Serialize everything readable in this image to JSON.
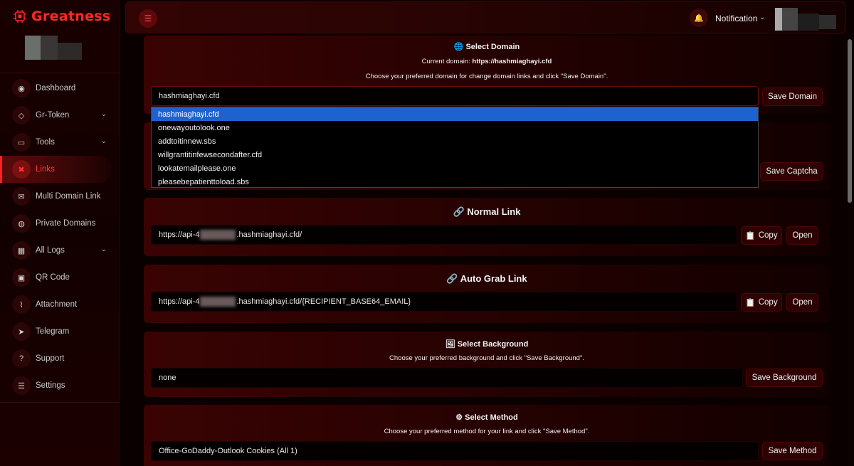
{
  "brand": {
    "name": "Greatness"
  },
  "sidebar": {
    "items": [
      {
        "label": "Dashboard",
        "icon": "gauge-icon",
        "glyph": "◉"
      },
      {
        "label": "Gr-Token",
        "icon": "diamond-icon",
        "glyph": "◇",
        "expandable": true
      },
      {
        "label": "Tools",
        "icon": "laptop-icon",
        "glyph": "▭",
        "expandable": true
      },
      {
        "label": "Links",
        "icon": "link-icon",
        "glyph": "✖",
        "active": true
      },
      {
        "label": "Multi Domain Link",
        "icon": "envelope-icon",
        "glyph": "✉"
      },
      {
        "label": "Private Domains",
        "icon": "globe-icon",
        "glyph": "◍"
      },
      {
        "label": "All Logs",
        "icon": "grid-icon",
        "glyph": "▦",
        "expandable": true
      },
      {
        "label": "QR Code",
        "icon": "qr-icon",
        "glyph": "▣"
      },
      {
        "label": "Attachment",
        "icon": "paperclip-icon",
        "glyph": "⌇"
      },
      {
        "label": "Telegram",
        "icon": "telegram-icon",
        "glyph": "➤"
      },
      {
        "label": "Support",
        "icon": "question-icon",
        "glyph": "?"
      },
      {
        "label": "Settings",
        "icon": "sliders-icon",
        "glyph": "☰"
      }
    ]
  },
  "topbar": {
    "notification_label": "Notification"
  },
  "select_domain": {
    "title": "Select Domain",
    "current_label": "Current domain:",
    "current_value": "https://hashmiaghayi.cfd",
    "hint": "Choose your preferred domain for change domain links and click \"Save Domain\".",
    "selected": "hashmiaghayi.cfd",
    "save_label": "Save Domain",
    "options": [
      "hashmiaghayi.cfd",
      "onewayoutolook.one",
      "addtoitinnew.sbs",
      "willgrantitinfewsecondafter.cfd",
      "lookatemailplease.one",
      "pleasebepatienttoload.sbs"
    ]
  },
  "captcha": {
    "save_label": "Save Captcha"
  },
  "normal_link": {
    "title": "Normal Link",
    "prefix": "https://api-4",
    "suffix": ".hashmiaghayi.cfd/",
    "copy_label": "Copy",
    "open_label": "Open"
  },
  "auto_grab_link": {
    "title": "Auto Grab Link",
    "prefix": "https://api-4",
    "suffix": ".hashmiaghayi.cfd/{RECIPIENT_BASE64_EMAIL}",
    "copy_label": "Copy",
    "open_label": "Open"
  },
  "select_background": {
    "title": "Select Background",
    "hint": "Choose your preferred background and click \"Save Background\".",
    "value": "none",
    "save_label": "Save Background"
  },
  "select_method": {
    "title": "Select Method",
    "hint": "Choose your preferred method for your link and click \"Save Method\".",
    "value": "Office-GoDaddy-Outlook Cookies (All 1)",
    "save_label": "Save Method"
  },
  "colors": {
    "accent": "#ff2626",
    "card": "#3a0303",
    "selected": "#1e62d0"
  }
}
